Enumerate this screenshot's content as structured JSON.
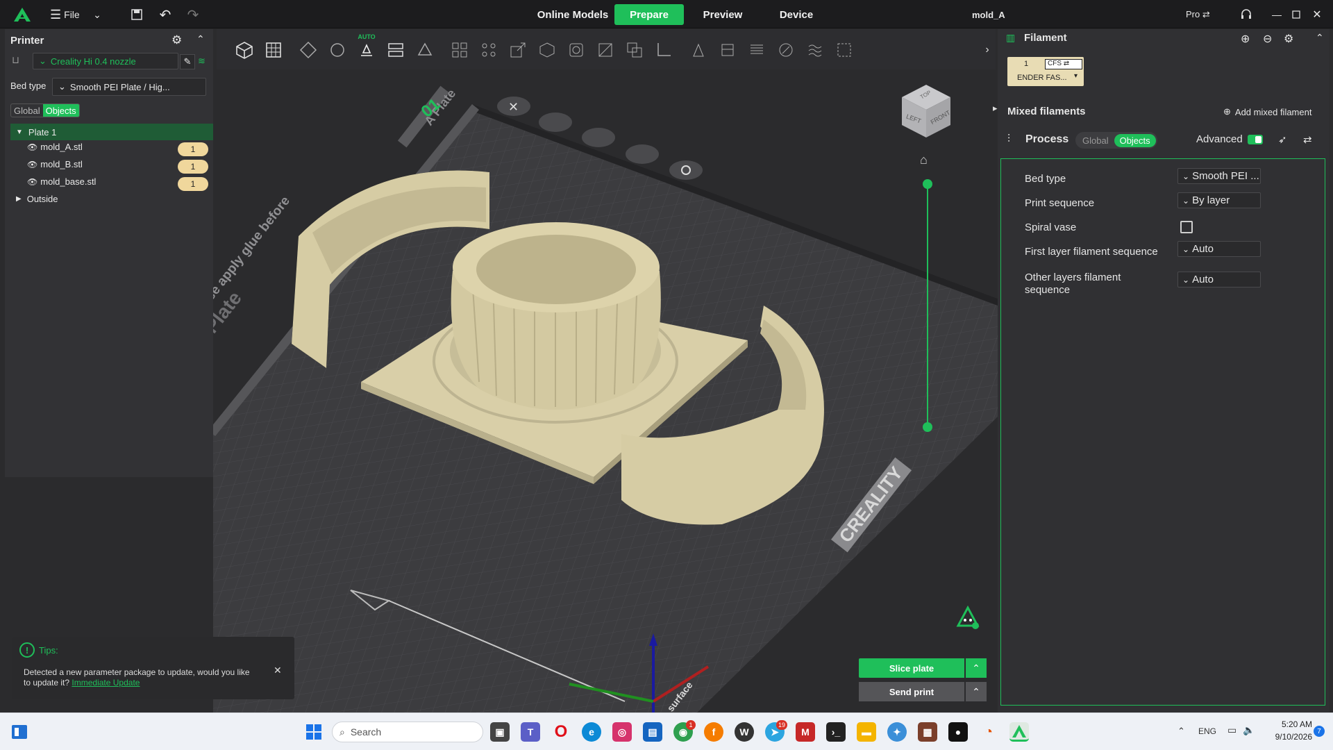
{
  "app": {
    "file_label": "File",
    "window_title": "mold_A",
    "pro_label": "Pro ⇄"
  },
  "nav": {
    "tabs": [
      {
        "label": "Online Models",
        "active": false
      },
      {
        "label": "Prepare",
        "active": true
      },
      {
        "label": "Preview",
        "active": false
      },
      {
        "label": "Device",
        "active": false
      }
    ]
  },
  "toolbar": {
    "auto_label": "AUTO"
  },
  "printer": {
    "title": "Printer",
    "nozzle": "Creality Hi 0.4 nozzle",
    "bed_type_label": "Bed type",
    "bed_type_value": "Smooth PEI Plate / Hig...",
    "tab_global": "Global",
    "tab_objects": "Objects"
  },
  "objects": {
    "plate": "Plate 1",
    "items": [
      {
        "name": "mold_A.stl",
        "count": "1"
      },
      {
        "name": "mold_B.stl",
        "count": "1"
      },
      {
        "name": "mold_base.stl",
        "count": "1"
      }
    ],
    "outside": "Outside"
  },
  "viewport": {
    "plate_number": "01",
    "plate_label": "A Plate",
    "bed_text_1": "Creality Smooth PEI Plate",
    "bed_text_2": "please apply glue before",
    "brand": "CREALITY",
    "surface_text": "surface",
    "cube_top": "TOP",
    "cube_left": "LEFT",
    "cube_front": "FRONT",
    "model_color": "#d9cfa8"
  },
  "tips": {
    "title": "Tips:",
    "message": "Detected a new parameter package to update, would you like to update it?",
    "link": "Immediate Update"
  },
  "actions": {
    "slice": "Slice plate",
    "send": "Send print"
  },
  "filament": {
    "title": "Filament",
    "slot_number": "1",
    "cfs_label": "CFS ⇄",
    "slot_name": "ENDER FAS...",
    "mixed_title": "Mixed filaments",
    "add_mixed": "Add mixed filament"
  },
  "process": {
    "title": "Process",
    "tab_global": "Global",
    "tab_objects": "Objects",
    "advanced_label": "Advanced",
    "advanced_on": true,
    "settings": [
      {
        "label": "Bed type",
        "value": "Smooth PEI ..."
      },
      {
        "label": "Print sequence",
        "value": "By layer"
      },
      {
        "label": "Spiral vase",
        "value": ""
      },
      {
        "label": "First layer filament sequence",
        "value": "Auto"
      },
      {
        "label": "Other layers filament sequence",
        "value": "Auto"
      }
    ]
  },
  "taskbar": {
    "search_placeholder": "Search",
    "lang": "ENG",
    "time": "5:20 AM",
    "date": "9/10/2026",
    "notif_count": "7",
    "chrome_badge": "1",
    "telegram_badge": "19"
  },
  "colors": {
    "accent": "#1fbf5a",
    "bg": "#2b2b2d",
    "panel": "#323235",
    "highlight": "#1f5c36"
  }
}
